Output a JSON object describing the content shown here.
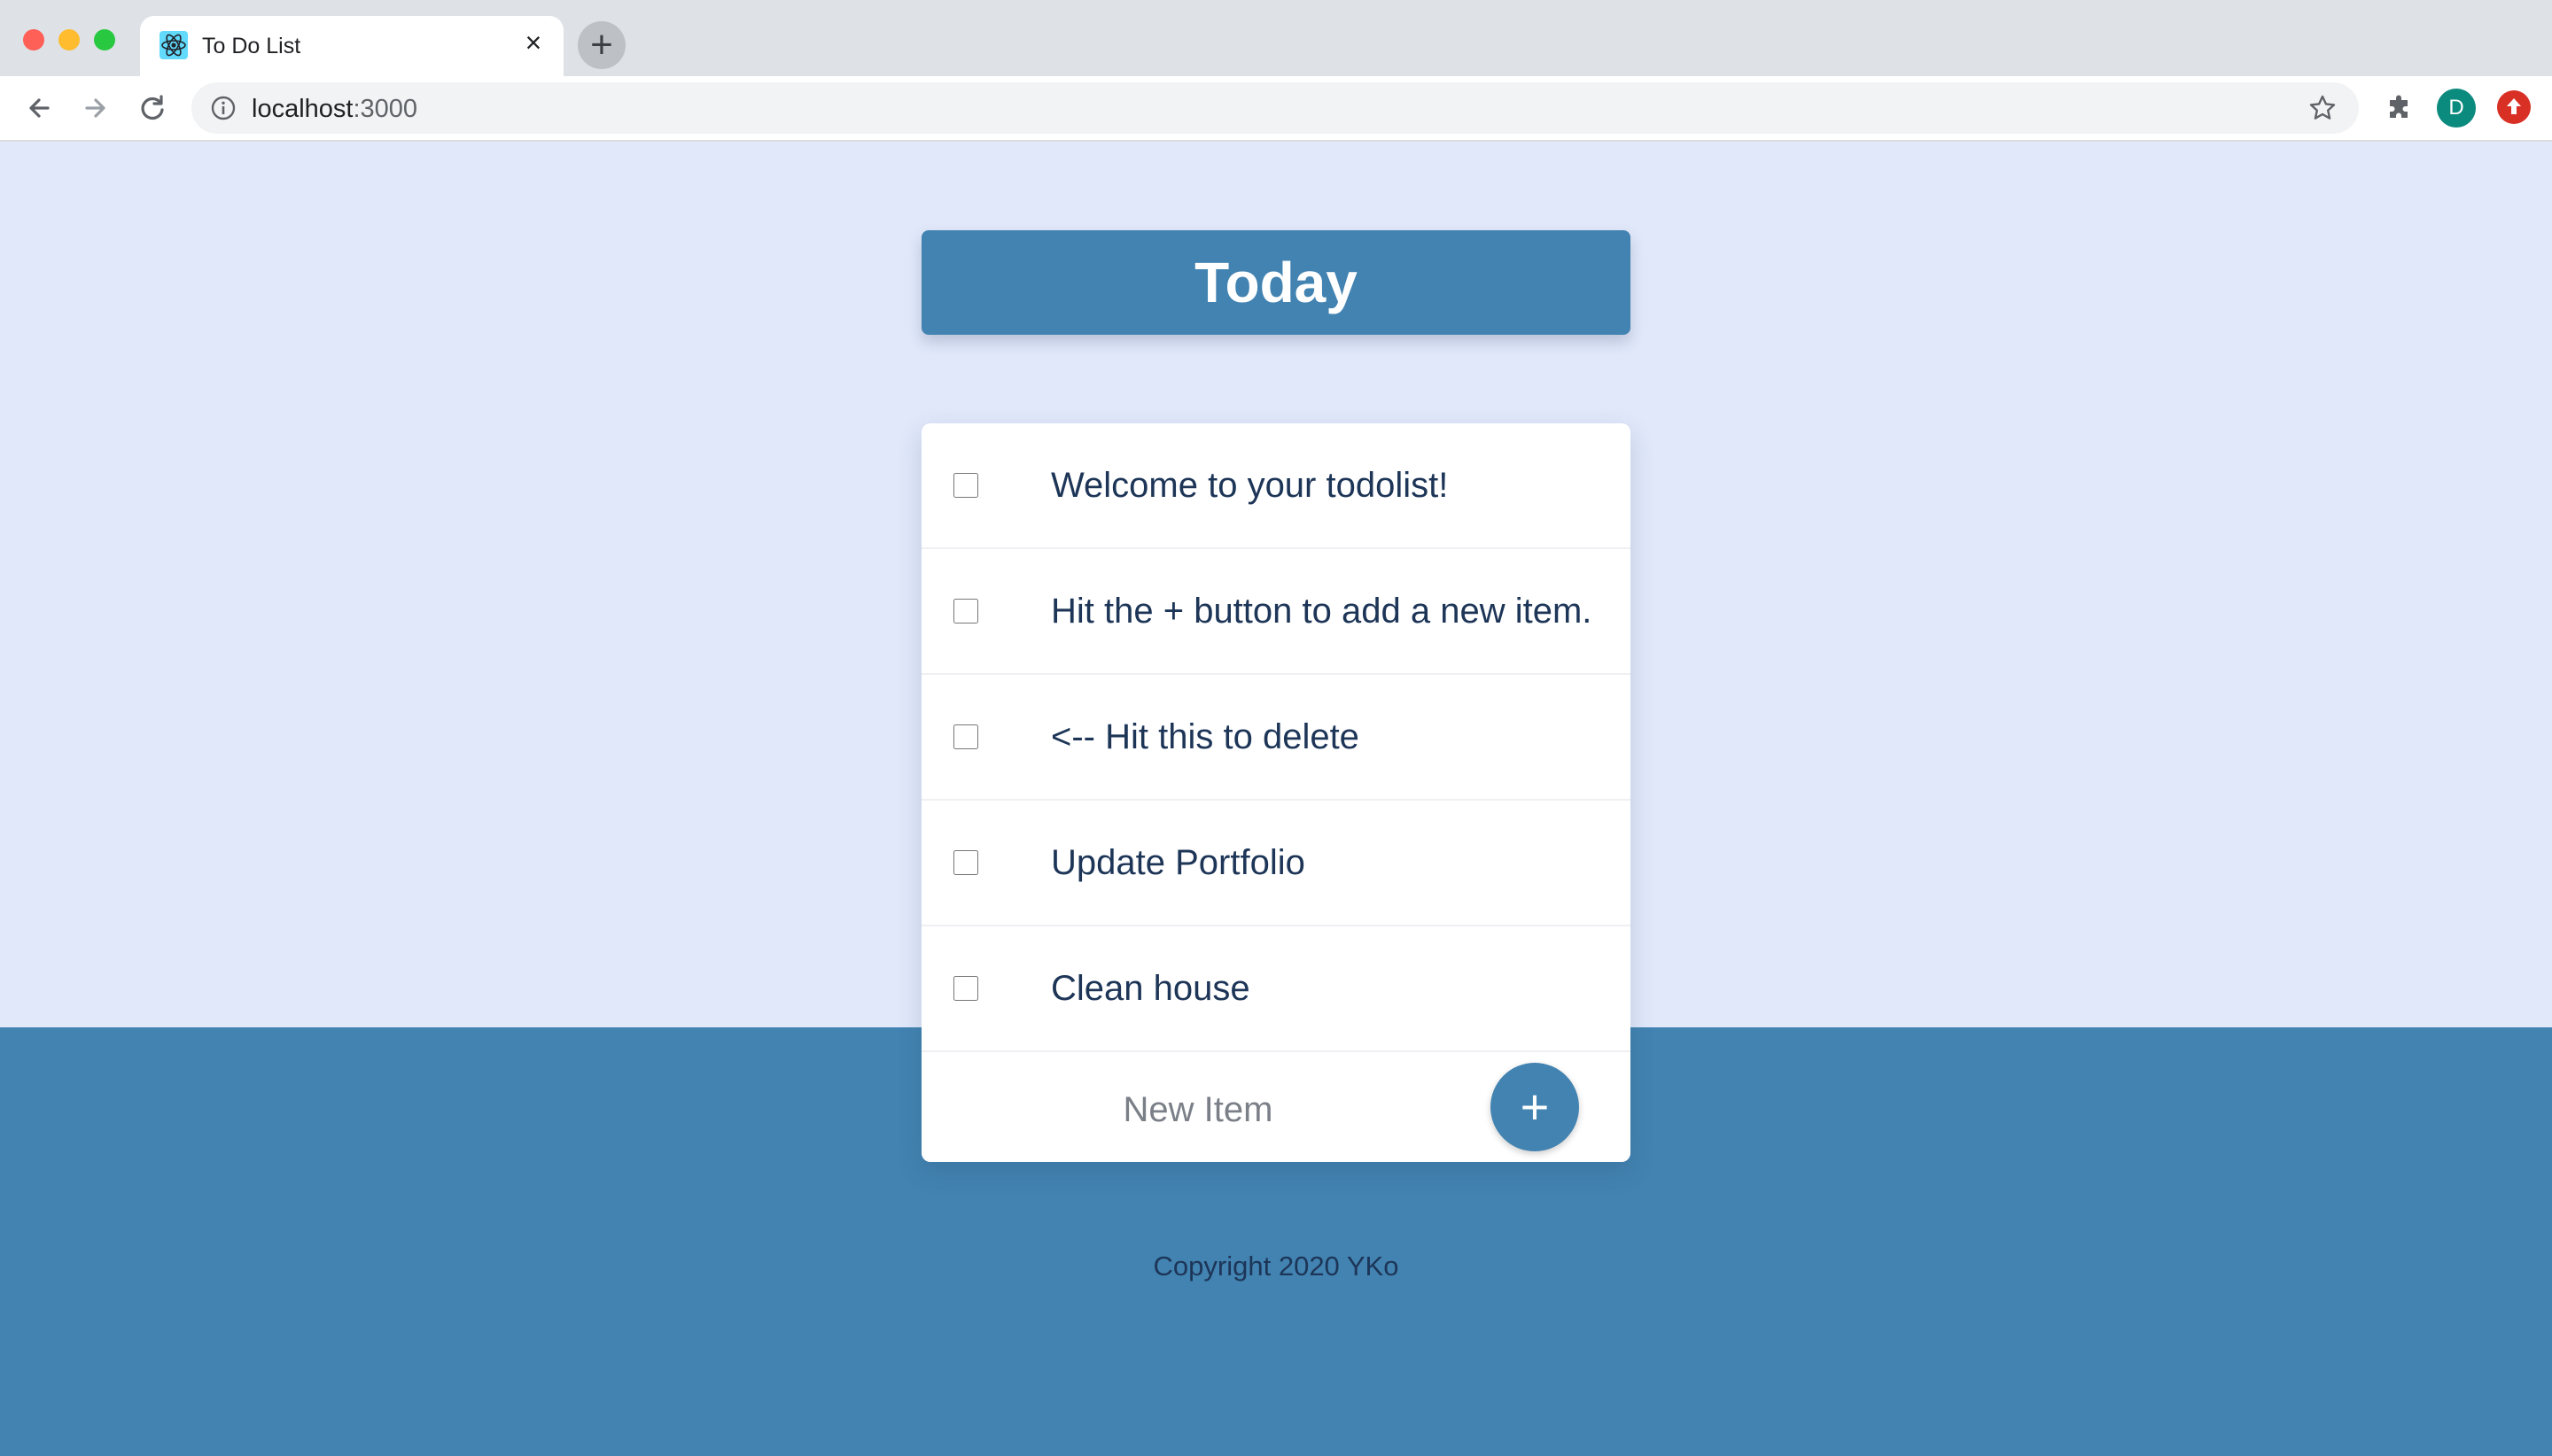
{
  "browser": {
    "tab_title": "To Do List",
    "tab_close": "×",
    "new_tab": "+",
    "url_host": "localhost",
    "url_port": ":3000",
    "profile_initial": "D",
    "icons": [
      "back-arrow-icon",
      "forward-arrow-icon",
      "reload-icon",
      "info-icon",
      "star-icon",
      "extensions-icon",
      "update-icon",
      "react-icon"
    ]
  },
  "page": {
    "heading": "Today",
    "items": [
      {
        "text": "Welcome to your todolist!",
        "checked": false
      },
      {
        "text": "Hit the + button to add a new item.",
        "checked": false
      },
      {
        "text": "<-- Hit this to delete",
        "checked": false
      },
      {
        "text": "Update Portfolio",
        "checked": false
      },
      {
        "text": "Clean house",
        "checked": false
      }
    ],
    "new_item_placeholder": "New Item",
    "add_button_label": "+",
    "footer": "Copyright 2020 YKo"
  },
  "colors": {
    "accent": "#4283b1",
    "page_background": "#e1e8fa",
    "card_background": "#ffffff",
    "text": "#1d3557"
  }
}
